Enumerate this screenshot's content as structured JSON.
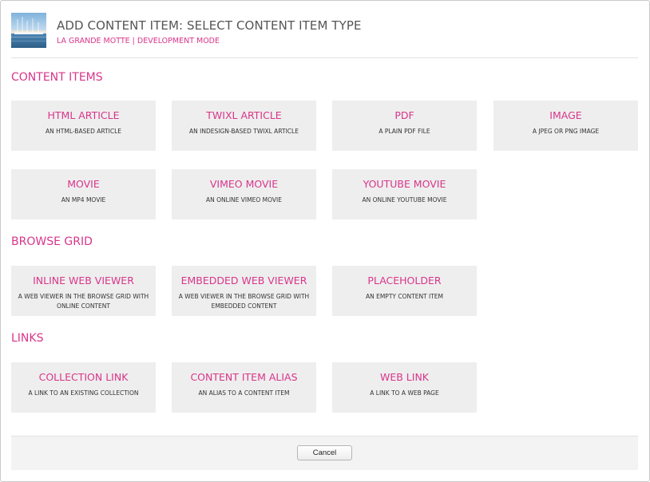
{
  "header": {
    "title": "ADD CONTENT ITEM: SELECT CONTENT ITEM TYPE",
    "subtitle": "LA GRANDE MOTTE | DEVELOPMENT MODE"
  },
  "sections": [
    {
      "title": "CONTENT ITEMS",
      "items": [
        {
          "title": "HTML ARTICLE",
          "desc": "AN HTML-BASED ARTICLE"
        },
        {
          "title": "TWIXL ARTICLE",
          "desc": "AN INDESIGN-BASED TWIXL ARTICLE"
        },
        {
          "title": "PDF",
          "desc": "A PLAIN PDF FILE"
        },
        {
          "title": "IMAGE",
          "desc": "A JPEG OR PNG IMAGE"
        },
        {
          "title": "MOVIE",
          "desc": "AN MP4 MOVIE"
        },
        {
          "title": "VIMEO MOVIE",
          "desc": "AN ONLINE VIMEO MOVIE"
        },
        {
          "title": "YOUTUBE MOVIE",
          "desc": "AN ONLINE YOUTUBE MOVIE"
        }
      ]
    },
    {
      "title": "BROWSE GRID",
      "items": [
        {
          "title": "INLINE WEB VIEWER",
          "desc": "A WEB VIEWER IN THE BROWSE GRID WITH ONLINE CONTENT"
        },
        {
          "title": "EMBEDDED WEB VIEWER",
          "desc": "A WEB VIEWER IN THE BROWSE GRID WITH EMBEDDED CONTENT"
        },
        {
          "title": "PLACEHOLDER",
          "desc": "AN EMPTY CONTENT ITEM"
        }
      ]
    },
    {
      "title": "LINKS",
      "items": [
        {
          "title": "COLLECTION LINK",
          "desc": "A LINK TO AN EXISTING COLLECTION"
        },
        {
          "title": "CONTENT ITEM ALIAS",
          "desc": "AN ALIAS TO A CONTENT ITEM"
        },
        {
          "title": "WEB LINK",
          "desc": "A LINK TO A WEB PAGE"
        }
      ]
    }
  ],
  "footer": {
    "cancel_label": "Cancel"
  },
  "colors": {
    "accent": "#d9358a",
    "tile_bg": "#eeeeee",
    "title_text": "#555555"
  },
  "icons": {
    "thumbnail": "marina-photo-thumbnail"
  }
}
